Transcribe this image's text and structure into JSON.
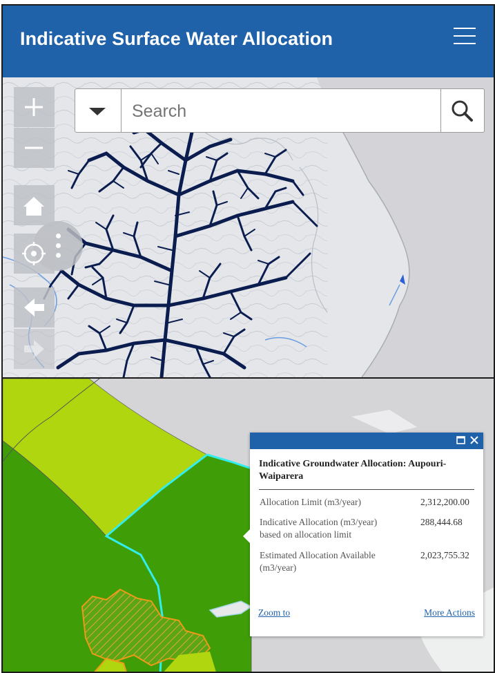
{
  "app": {
    "title": "Indicative Surface Water Allocation"
  },
  "search": {
    "placeholder": "Search",
    "value": ""
  },
  "map_controls": {
    "zoom_in": "+",
    "zoom_out": "−"
  },
  "popup": {
    "title": "Indicative Groundwater Allocation: Aupouri-Waiparera",
    "attributes": [
      {
        "label": "Allocation Limit (m3/year)",
        "value": "2,312,200.00"
      },
      {
        "label": "Indicative Allocation (m3/year) based on allocation limit",
        "value": "288,444.68"
      },
      {
        "label": "Estimated Allocation Available (m3/year)",
        "value": "2,023,755.32"
      }
    ],
    "zoom_link": "Zoom to",
    "actions_link": "More Actions"
  },
  "colors": {
    "header_blue": "#1f62aa",
    "river_navy": "#0b1d4f",
    "zone_dark_green": "#3f9e08",
    "zone_light_green": "#b0d60f",
    "boundary_cyan": "#33ecec",
    "hatch_orange": "#ee9a18"
  },
  "icons": [
    "hamburger-menu-icon",
    "plus-icon",
    "minus-icon",
    "more-vertical-icon",
    "home-icon",
    "locate-icon",
    "arrow-left-icon",
    "arrow-right-icon",
    "caret-down-icon",
    "search-icon",
    "maximize-icon",
    "close-icon"
  ]
}
